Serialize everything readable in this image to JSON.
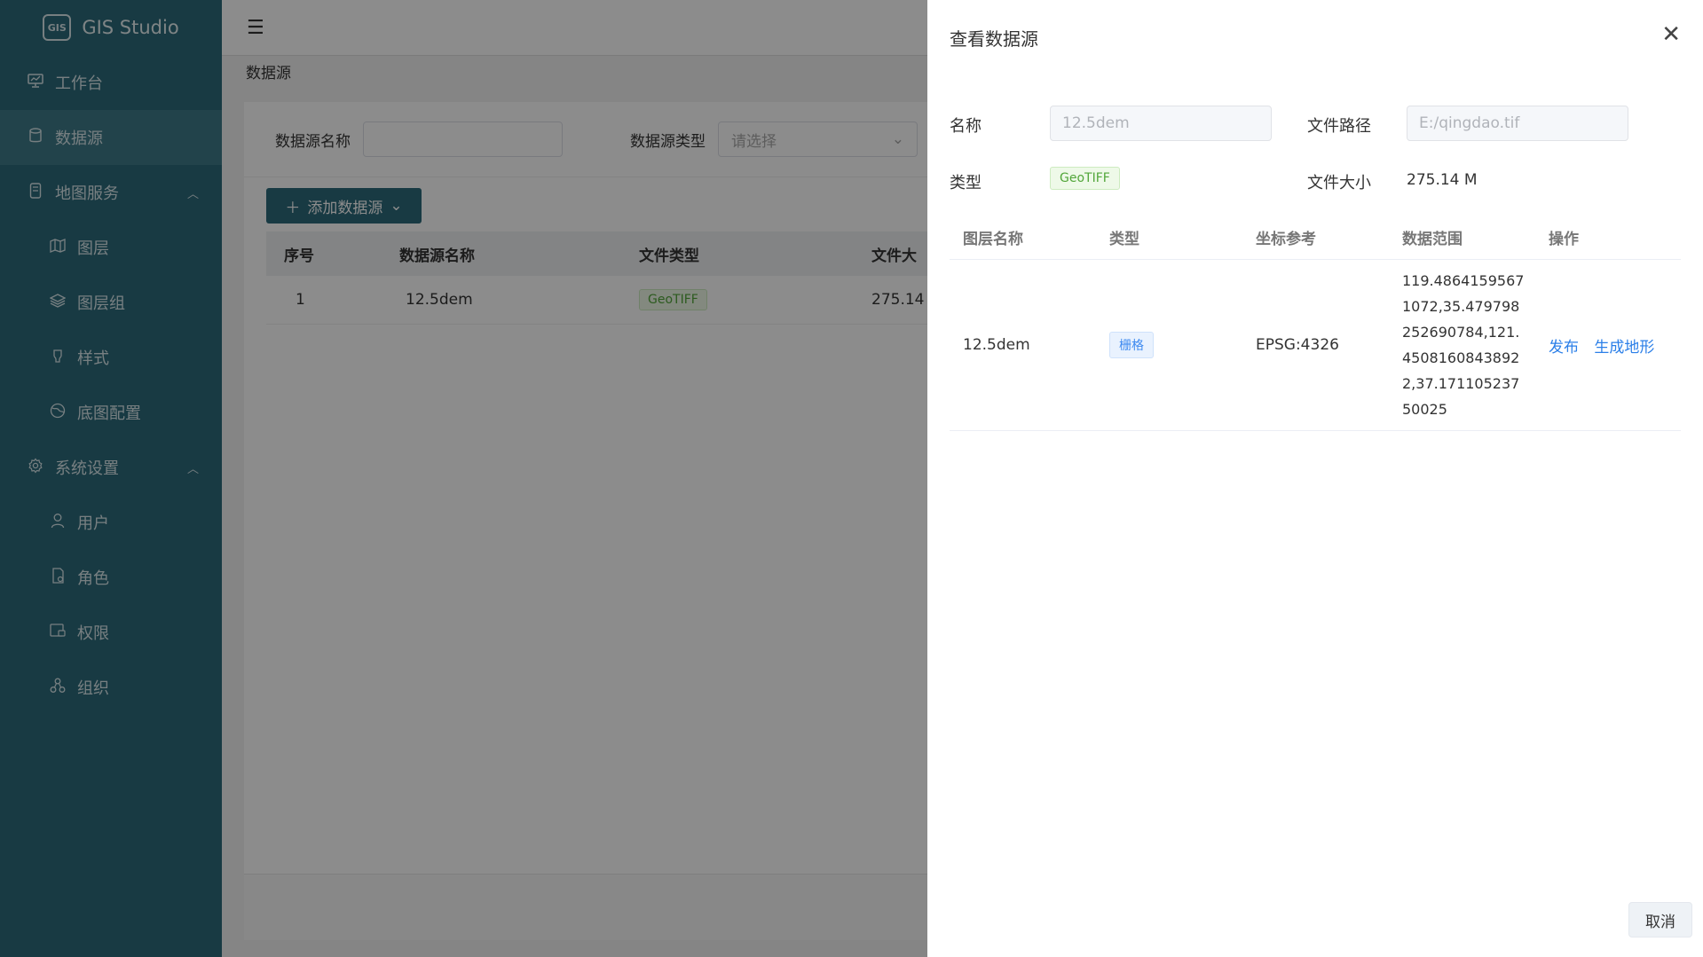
{
  "app": {
    "title": "GIS Studio",
    "logo_text": "GIS"
  },
  "sidebar": {
    "items": [
      {
        "label": "工作台",
        "icon": "monitor-icon"
      },
      {
        "label": "数据源",
        "icon": "database-icon",
        "active": true
      },
      {
        "label": "地图服务",
        "icon": "server-icon",
        "expanded": true,
        "children": [
          {
            "label": "图层",
            "icon": "map-icon"
          },
          {
            "label": "图层组",
            "icon": "layers-icon"
          },
          {
            "label": "样式",
            "icon": "brush-icon"
          },
          {
            "label": "底图配置",
            "icon": "globe-icon"
          }
        ]
      },
      {
        "label": "系统设置",
        "icon": "gear-icon",
        "expanded": true,
        "children": [
          {
            "label": "用户",
            "icon": "user-icon"
          },
          {
            "label": "角色",
            "icon": "role-icon"
          },
          {
            "label": "权限",
            "icon": "permission-icon"
          },
          {
            "label": "组织",
            "icon": "org-icon"
          }
        ]
      }
    ]
  },
  "main": {
    "breadcrumb": "数据源",
    "search": {
      "name_label": "数据源名称",
      "name_value": "",
      "type_label": "数据源类型",
      "type_placeholder": "请选择"
    },
    "add_button": "添加数据源",
    "table": {
      "headers": [
        "序号",
        "数据源名称",
        "文件类型",
        "文件大"
      ],
      "rows": [
        {
          "index": "1",
          "name": "12.5dem",
          "type": "GeoTIFF",
          "size": "275.14"
        }
      ]
    }
  },
  "drawer": {
    "title": "查看数据源",
    "name_label": "名称",
    "name_value": "12.5dem",
    "path_label": "文件路径",
    "path_value": "E:/qingdao.tif",
    "type_label": "类型",
    "type_value": "GeoTIFF",
    "size_label": "文件大小",
    "size_value": "275.14 M",
    "table": {
      "headers": [
        "图层名称",
        "类型",
        "坐标参考",
        "数据范围",
        "操作"
      ],
      "rows": [
        {
          "name": "12.5dem",
          "type": "栅格",
          "crs": "EPSG:4326",
          "range": "119.48641595671072,35.479798252690784,121.45081608438922,37.17110523750025",
          "actions": [
            "发布",
            "生成地形"
          ]
        }
      ]
    },
    "cancel_label": "取消"
  },
  "colors": {
    "sidebar_bg": "#2c6a7a",
    "accent_link": "#2b7fe8",
    "tag_green": "#52a63a",
    "tag_blue": "#3e8af0"
  }
}
